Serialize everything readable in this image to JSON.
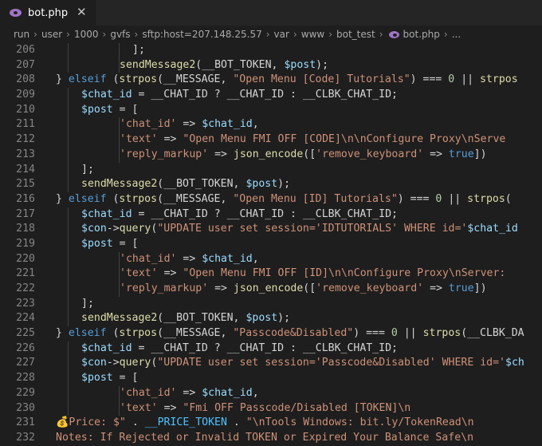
{
  "tab": {
    "label": "bot.php",
    "icon": "php-elephant-icon",
    "close": "✕"
  },
  "breadcrumb": [
    "run",
    "user",
    "1000",
    "gvfs",
    "sftp:host=207.148.25.57",
    "var",
    "www",
    "bot_test",
    "bot.php",
    "..."
  ],
  "lines": [
    {
      "n": "206",
      "ind": 6,
      "t": [
        [
          "];",
          "p"
        ]
      ]
    },
    {
      "n": "207",
      "ind": 5,
      "t": [
        [
          "sendMessage2",
          "f"
        ],
        [
          "(__BOT_TOKEN, ",
          "p"
        ],
        [
          "$post",
          "v"
        ],
        [
          ");",
          "p"
        ]
      ]
    },
    {
      "n": "208",
      "ind": 0,
      "t": [
        [
          "} ",
          "p"
        ],
        [
          "elseif",
          "k"
        ],
        [
          " (",
          "p"
        ],
        [
          "strpos",
          "f"
        ],
        [
          "(__MESSAGE, ",
          "p"
        ],
        [
          "\"Open Menu [Code] Tutorials\"",
          "s"
        ],
        [
          ") === ",
          "p"
        ],
        [
          "0",
          "n"
        ],
        [
          " || ",
          "p"
        ],
        [
          "strpos",
          "f"
        ]
      ]
    },
    {
      "n": "209",
      "ind": 2,
      "t": [
        [
          "$chat_id",
          "v"
        ],
        [
          " = __CHAT_ID ? __CHAT_ID : __CLBK_CHAT_ID;",
          "p"
        ]
      ]
    },
    {
      "n": "210",
      "ind": 2,
      "t": [
        [
          "$post",
          "v"
        ],
        [
          " = [",
          "p"
        ]
      ]
    },
    {
      "n": "211",
      "ind": 5,
      "t": [
        [
          "'chat_id'",
          "s"
        ],
        [
          " => ",
          "p"
        ],
        [
          "$chat_id",
          "v"
        ],
        [
          ",",
          "p"
        ]
      ]
    },
    {
      "n": "212",
      "ind": 5,
      "t": [
        [
          "'text'",
          "s"
        ],
        [
          " => ",
          "p"
        ],
        [
          "\"Open Menu FMI OFF [CODE]\\n\\nConfigure Proxy\\nServe",
          "s"
        ]
      ]
    },
    {
      "n": "213",
      "ind": 5,
      "t": [
        [
          "'reply_markup'",
          "s"
        ],
        [
          " => ",
          "p"
        ],
        [
          "json_encode",
          "f"
        ],
        [
          "([",
          "p"
        ],
        [
          "'remove_keyboard'",
          "s"
        ],
        [
          " => ",
          "p"
        ],
        [
          "true",
          "k"
        ],
        [
          "])",
          "p"
        ]
      ]
    },
    {
      "n": "214",
      "ind": 2,
      "t": [
        [
          "];",
          "p"
        ]
      ]
    },
    {
      "n": "215",
      "ind": 2,
      "t": [
        [
          "sendMessage2",
          "f"
        ],
        [
          "(__BOT_TOKEN, ",
          "p"
        ],
        [
          "$post",
          "v"
        ],
        [
          ");",
          "p"
        ]
      ]
    },
    {
      "n": "216",
      "ind": 0,
      "t": [
        [
          "} ",
          "p"
        ],
        [
          "elseif",
          "k"
        ],
        [
          " (",
          "p"
        ],
        [
          "strpos",
          "f"
        ],
        [
          "(__MESSAGE, ",
          "p"
        ],
        [
          "\"Open Menu [ID] Tutorials\"",
          "s"
        ],
        [
          ") === ",
          "p"
        ],
        [
          "0",
          "n"
        ],
        [
          " || ",
          "p"
        ],
        [
          "strpos",
          "f"
        ],
        [
          "(",
          "p"
        ]
      ]
    },
    {
      "n": "217",
      "ind": 2,
      "t": [
        [
          "$chat_id",
          "v"
        ],
        [
          " = __CHAT_ID ? __CHAT_ID : __CLBK_CHAT_ID;",
          "p"
        ]
      ]
    },
    {
      "n": "218",
      "ind": 2,
      "t": [
        [
          "$con",
          "v"
        ],
        [
          "->",
          "p"
        ],
        [
          "query",
          "f"
        ],
        [
          "(",
          "p"
        ],
        [
          "\"UPDATE user set session='IDTUTORIALS' WHERE id='",
          "s"
        ],
        [
          "$chat_id",
          "v"
        ]
      ]
    },
    {
      "n": "219",
      "ind": 2,
      "t": [
        [
          "$post",
          "v"
        ],
        [
          " = [",
          "p"
        ]
      ]
    },
    {
      "n": "220",
      "ind": 5,
      "t": [
        [
          "'chat_id'",
          "s"
        ],
        [
          " => ",
          "p"
        ],
        [
          "$chat_id",
          "v"
        ],
        [
          ",",
          "p"
        ]
      ]
    },
    {
      "n": "221",
      "ind": 5,
      "t": [
        [
          "'text'",
          "s"
        ],
        [
          " => ",
          "p"
        ],
        [
          "\"Open Menu FMI OFF [ID]\\n\\nConfigure Proxy\\nServer:",
          "s"
        ]
      ]
    },
    {
      "n": "222",
      "ind": 5,
      "t": [
        [
          "'reply_markup'",
          "s"
        ],
        [
          " => ",
          "p"
        ],
        [
          "json_encode",
          "f"
        ],
        [
          "([",
          "p"
        ],
        [
          "'remove_keyboard'",
          "s"
        ],
        [
          " => ",
          "p"
        ],
        [
          "true",
          "k"
        ],
        [
          "])",
          "p"
        ]
      ]
    },
    {
      "n": "223",
      "ind": 2,
      "t": [
        [
          "];",
          "p"
        ]
      ]
    },
    {
      "n": "224",
      "ind": 2,
      "t": [
        [
          "sendMessage2",
          "f"
        ],
        [
          "(__BOT_TOKEN, ",
          "p"
        ],
        [
          "$post",
          "v"
        ],
        [
          ");",
          "p"
        ]
      ]
    },
    {
      "n": "225",
      "ind": 0,
      "t": [
        [
          "} ",
          "p"
        ],
        [
          "elseif",
          "k"
        ],
        [
          " (",
          "p"
        ],
        [
          "strpos",
          "f"
        ],
        [
          "(__MESSAGE, ",
          "p"
        ],
        [
          "\"Passcode&Disabled\"",
          "s"
        ],
        [
          ") === ",
          "p"
        ],
        [
          "0",
          "n"
        ],
        [
          " || ",
          "p"
        ],
        [
          "strpos",
          "f"
        ],
        [
          "(__CLBK_DA",
          "p"
        ]
      ]
    },
    {
      "n": "226",
      "ind": 2,
      "t": [
        [
          "$chat_id",
          "v"
        ],
        [
          " = __CHAT_ID ? __CHAT_ID : __CLBK_CHAT_ID;",
          "p"
        ]
      ]
    },
    {
      "n": "227",
      "ind": 2,
      "t": [
        [
          "$con",
          "v"
        ],
        [
          "->",
          "p"
        ],
        [
          "query",
          "f"
        ],
        [
          "(",
          "p"
        ],
        [
          "\"UPDATE user set session='Passcode&Disabled' WHERE id='",
          "s"
        ],
        [
          "$ch",
          "v"
        ]
      ]
    },
    {
      "n": "228",
      "ind": 2,
      "t": [
        [
          "$post",
          "v"
        ],
        [
          " = [",
          "p"
        ]
      ]
    },
    {
      "n": "229",
      "ind": 5,
      "t": [
        [
          "'chat_id'",
          "s"
        ],
        [
          " => ",
          "p"
        ],
        [
          "$chat_id",
          "v"
        ],
        [
          ",",
          "p"
        ]
      ]
    },
    {
      "n": "230",
      "ind": 5,
      "t": [
        [
          "'text'",
          "s"
        ],
        [
          " => ",
          "p"
        ],
        [
          "\"Fmi OFF Passcode/Disabled [TOKEN]\\n",
          "s"
        ]
      ]
    },
    {
      "n": "231",
      "ind": 0,
      "t": [
        [
          "💰Price: $\"",
          "s"
        ],
        [
          " . ",
          "p"
        ],
        [
          "__PRICE_TOKEN",
          "c"
        ],
        [
          " . ",
          "p"
        ],
        [
          "\"\\nTools Windows: bit.ly/TokenRead\\n",
          "s"
        ]
      ]
    },
    {
      "n": "232",
      "ind": 0,
      "t": [
        [
          "Notes: If Rejected or Invalid TOKEN or Expired Your Balance Safe\\n",
          "s"
        ]
      ]
    }
  ]
}
